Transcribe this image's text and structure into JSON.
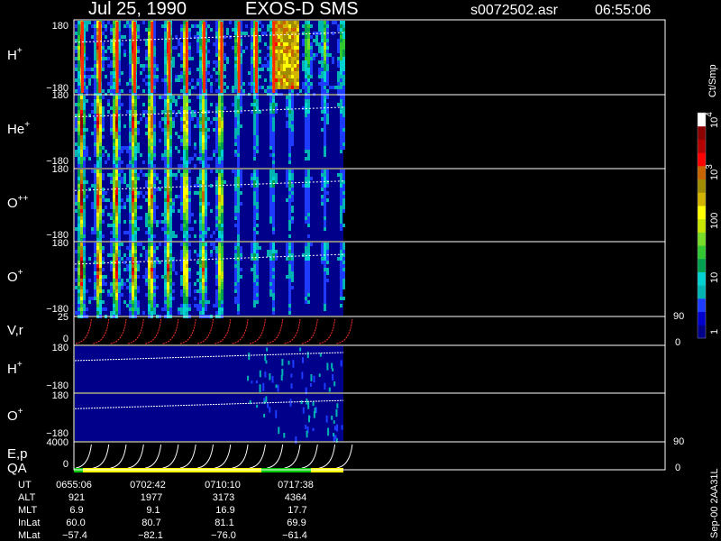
{
  "header": {
    "date": "Jul 25, 1990",
    "instrument": "EXOS-D SMS",
    "file": "s0072502.asr",
    "time": "06:55:06"
  },
  "colorbar": {
    "unit_label": "Ct/Smp",
    "tick_labels": [
      "1",
      "10",
      "100",
      "10",
      "10"
    ],
    "tick_exponents": [
      "",
      "",
      "",
      "3",
      "4"
    ],
    "colors": [
      "#00008b",
      "#0000cd",
      "#1e3cff",
      "#00b4b4",
      "#00d2d2",
      "#00a050",
      "#32c832",
      "#78dc28",
      "#c8e600",
      "#ffff00",
      "#d2b400",
      "#a08c00",
      "#c86400",
      "#ff0000",
      "#b40000",
      "#8b0000",
      "#ffffff"
    ]
  },
  "panels": [
    {
      "label": "H",
      "sup": "+",
      "y_top": "180",
      "y_bottom": "−180"
    },
    {
      "label": "He",
      "sup": "+",
      "y_top": "180",
      "y_bottom": "−180"
    },
    {
      "label": "O",
      "sup": "++",
      "y_top": "180",
      "y_bottom": "−180"
    },
    {
      "label": "O",
      "sup": "+",
      "y_top": "180",
      "y_bottom": "−180"
    },
    {
      "label": "V,r",
      "sup": "",
      "y_top": "25",
      "y_bottom": "0",
      "right_top": "90",
      "right_bottom": "0"
    },
    {
      "label": "H",
      "sup": "+",
      "y_top": "180",
      "y_bottom": "−180"
    },
    {
      "label": "O",
      "sup": "+",
      "y_top": "180",
      "y_bottom": "−180"
    },
    {
      "label": "E,p",
      "sup": "",
      "y_top": "4000",
      "y_bottom": "0",
      "right_top": "90",
      "right_bottom": "0",
      "label2": "QA"
    }
  ],
  "footer": {
    "row_labels": [
      "UT",
      "ALT",
      "MLT",
      "InLat",
      "MLat"
    ],
    "columns": [
      [
        "0655:06",
        "921",
        "6.9",
        "60.0",
        "−57.4"
      ],
      [
        "0702:42",
        "1977",
        "9.1",
        "80.7",
        "−82.1"
      ],
      [
        "0710:10",
        "3173",
        "16.9",
        "81.1",
        "−76.0"
      ],
      [
        "0717:38",
        "4364",
        "17.7",
        "69.9",
        "−61.4"
      ]
    ],
    "version": "Sep-00 2AA31L"
  },
  "chart_data": {
    "type": "heatmap",
    "title": "Jul 25, 1990 EXOS-D SMS",
    "x": {
      "tick_labels": [
        "0655:06",
        "0702:42",
        "0710:10",
        "0717:38"
      ]
    },
    "panels": [
      "H+",
      "He+",
      "O++",
      "O+",
      "V,r",
      "H+",
      "O+",
      "E,p"
    ],
    "color_scale": {
      "label": "Ct/Smp",
      "log": true,
      "range": [
        1,
        10000
      ]
    },
    "data_coverage": "0655:06 to approximately 0720 UT",
    "qa_bar": [
      {
        "color": "#00c800",
        "span": "start"
      },
      {
        "color": "#ffff00",
        "span": "0656 - 0713"
      },
      {
        "color": "#00c800",
        "span": "0713 - 0717"
      },
      {
        "color": "#ffff00",
        "span": "0717 - end"
      }
    ]
  }
}
